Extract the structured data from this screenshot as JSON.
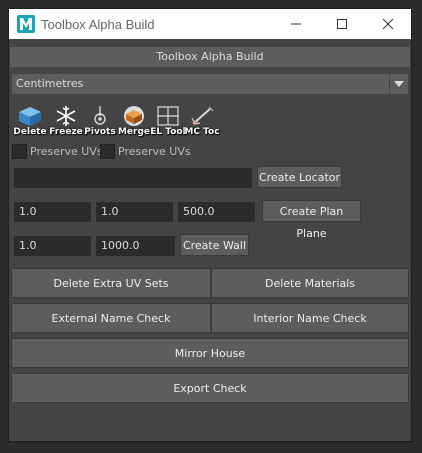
{
  "window": {
    "title": "Toolbox Alpha Build",
    "controls": [
      "minimize",
      "maximize",
      "close"
    ]
  },
  "header": {
    "title": "Toolbox Alpha Build"
  },
  "units_dropdown": {
    "selected": "Centimetres"
  },
  "shelf": {
    "tools": [
      {
        "label": "Delete",
        "icon": "delete-icon"
      },
      {
        "label": "Freeze",
        "icon": "freeze-icon"
      },
      {
        "label": "Pivots",
        "icon": "pivot-icon"
      },
      {
        "label": "Merge",
        "icon": "merge-icon"
      },
      {
        "label": "EL Tool",
        "icon": "edge-loop-icon"
      },
      {
        "label": "MC Toc",
        "icon": "multicut-icon"
      }
    ]
  },
  "checkboxes": [
    {
      "label": "Preserve UVs",
      "checked": false
    },
    {
      "label": "Preserve UVs",
      "checked": false
    }
  ],
  "locator": {
    "name_value": "",
    "button": "Create Locator"
  },
  "plan_plane": {
    "values": [
      "1.0",
      "1.0",
      "500.0"
    ],
    "button": "Create Plan Plane"
  },
  "wall": {
    "values": [
      "1.0",
      "1000.0"
    ],
    "button": "Create Wall"
  },
  "actions": {
    "delete_extra_uv_sets": "Delete Extra UV Sets",
    "delete_materials": "Delete Materials",
    "external_name_check": "External Name Check",
    "interior_name_check": "Interior Name Check",
    "mirror_house": "Mirror House",
    "export_check": "Export Check"
  },
  "colors": {
    "panel_bg": "#444444",
    "button_bg": "#5d5d5d",
    "field_bg": "#2b2b2b",
    "titlebar_bg": "#ffffff",
    "maya_icon": "#19a5b5"
  }
}
